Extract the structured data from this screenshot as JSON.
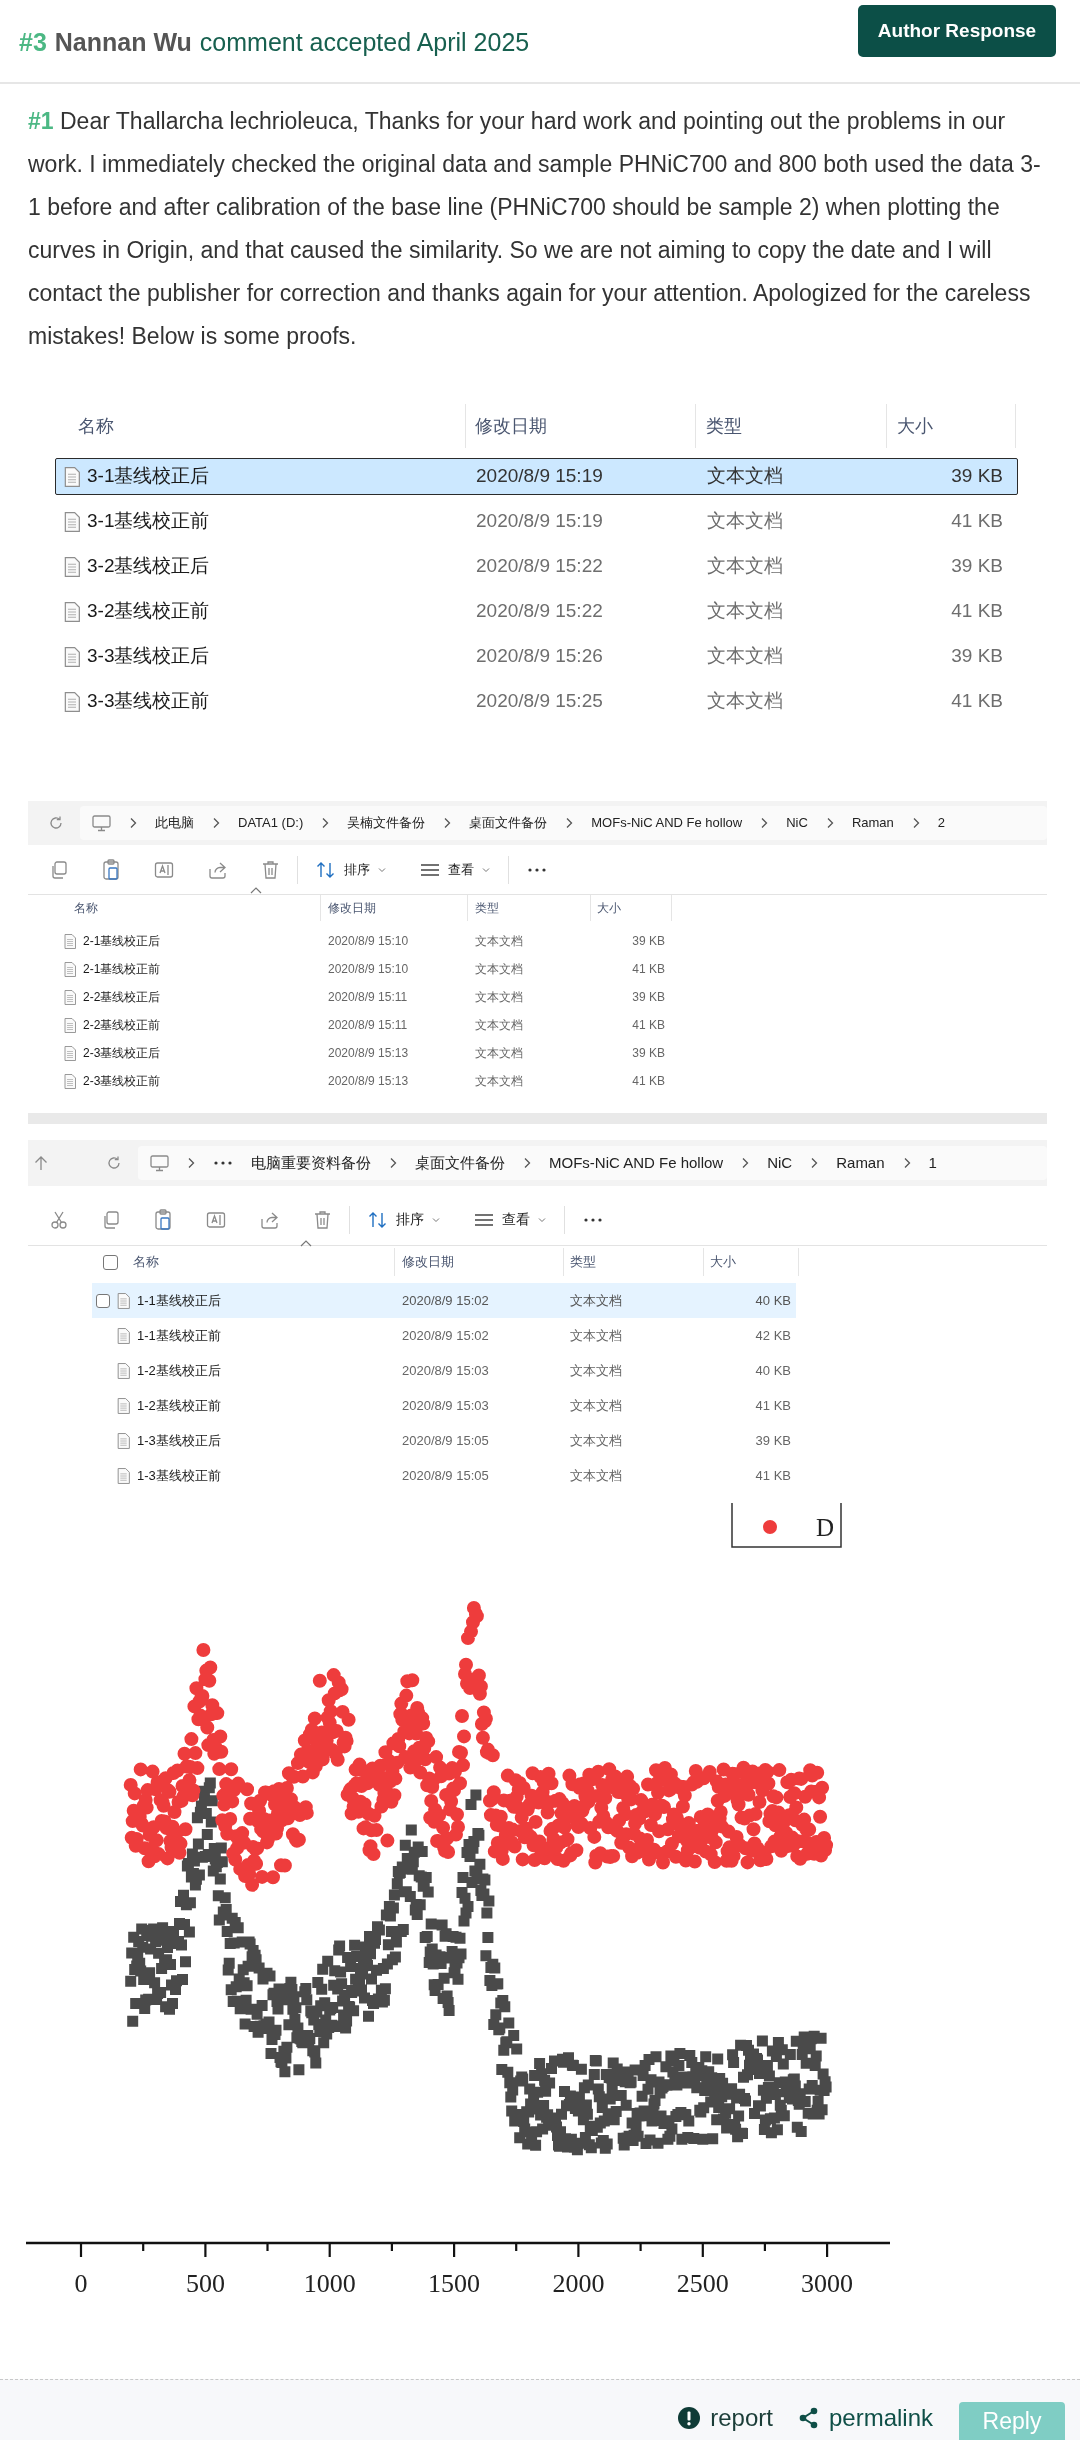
{
  "header": {
    "number": "#3",
    "author": "Nannan Wu",
    "status": "comment accepted April 2025",
    "button": "Author Response"
  },
  "comment": {
    "number": "#1",
    "text": "Dear Thallarcha lechrioleuca, Thanks for your hard work and pointing out the problems in our work. I immediately checked the original data and sample PHNiC700 and 800 both used the data 3-1 before and after calibration of the base line (PHNiC700 should be sample 2) when plotting the curves in Origin, and that caused the similarity. So we are not aiming to copy the date and I will contact the publisher for correction and thanks again for your attention. Apologized for the careless mistakes! Below is some proofs."
  },
  "screenshots": [
    {
      "kind": "large",
      "columns": [
        "名称",
        "修改日期",
        "类型",
        "大小"
      ],
      "files": [
        {
          "name": "3-1基线校正后",
          "date": "2020/8/9 15:19",
          "type": "文本文档",
          "size": "39 KB",
          "selected": true
        },
        {
          "name": "3-1基线校正前",
          "date": "2020/8/9 15:19",
          "type": "文本文档",
          "size": "41 KB",
          "selected": false
        },
        {
          "name": "3-2基线校正后",
          "date": "2020/8/9 15:22",
          "type": "文本文档",
          "size": "39 KB",
          "selected": false
        },
        {
          "name": "3-2基线校正前",
          "date": "2020/8/9 15:22",
          "type": "文本文档",
          "size": "41 KB",
          "selected": false
        },
        {
          "name": "3-3基线校正后",
          "date": "2020/8/9 15:26",
          "type": "文本文档",
          "size": "39 KB",
          "selected": false
        },
        {
          "name": "3-3基线校正前",
          "date": "2020/8/9 15:25",
          "type": "文本文档",
          "size": "41 KB",
          "selected": false
        }
      ]
    },
    {
      "kind": "small",
      "breadcrumb": [
        "此电脑",
        "DATA1 (D:)",
        "吴楠文件备份",
        "桌面文件备份",
        "MOFs-NiC AND Fe hollow",
        "NiC",
        "Raman",
        "2"
      ],
      "breadcrumb_collapsed": false,
      "toolbar": [
        "排序",
        "查看"
      ],
      "columns": [
        "名称",
        "修改日期",
        "类型",
        "大小"
      ],
      "files": [
        {
          "name": "2-1基线校正后",
          "date": "2020/8/9 15:10",
          "type": "文本文档",
          "size": "39 KB",
          "selected": false
        },
        {
          "name": "2-1基线校正前",
          "date": "2020/8/9 15:10",
          "type": "文本文档",
          "size": "41 KB",
          "selected": false
        },
        {
          "name": "2-2基线校正后",
          "date": "2020/8/9 15:11",
          "type": "文本文档",
          "size": "39 KB",
          "selected": false
        },
        {
          "name": "2-2基线校正前",
          "date": "2020/8/9 15:11",
          "type": "文本文档",
          "size": "41 KB",
          "selected": false
        },
        {
          "name": "2-3基线校正后",
          "date": "2020/8/9 15:13",
          "type": "文本文档",
          "size": "39 KB",
          "selected": false
        },
        {
          "name": "2-3基线校正前",
          "date": "2020/8/9 15:13",
          "type": "文本文档",
          "size": "41 KB",
          "selected": false
        }
      ]
    },
    {
      "kind": "medium",
      "breadcrumb": [
        "电脑重要资料备份",
        "桌面文件备份",
        "MOFs-NiC AND Fe hollow",
        "NiC",
        "Raman",
        "1"
      ],
      "breadcrumb_collapsed": true,
      "toolbar": [
        "排序",
        "查看"
      ],
      "header_checkbox": {
        "checked": false
      },
      "columns": [
        "名称",
        "修改日期",
        "类型",
        "大小"
      ],
      "files": [
        {
          "name": "1-1基线校正后",
          "date": "2020/8/9 15:02",
          "type": "文本文档",
          "size": "40 KB",
          "selected": true
        },
        {
          "name": "1-1基线校正前",
          "date": "2020/8/9 15:02",
          "type": "文本文档",
          "size": "42 KB",
          "selected": false
        },
        {
          "name": "1-2基线校正后",
          "date": "2020/8/9 15:03",
          "type": "文本文档",
          "size": "40 KB",
          "selected": false
        },
        {
          "name": "1-2基线校正前",
          "date": "2020/8/9 15:03",
          "type": "文本文档",
          "size": "41 KB",
          "selected": false
        },
        {
          "name": "1-3基线校正后",
          "date": "2020/8/9 15:05",
          "type": "文本文档",
          "size": "39 KB",
          "selected": false
        },
        {
          "name": "1-3基线校正前",
          "date": "2020/8/9 15:05",
          "type": "文本文档",
          "size": "41 KB",
          "selected": false
        }
      ]
    }
  ],
  "chart": {
    "legend": "D",
    "x_tick_labels": [
      "0",
      "500",
      "1000",
      "1500",
      "2000",
      "2500",
      "3000"
    ]
  },
  "footer": {
    "report": "report",
    "permalink": "permalink",
    "reply": "Reply"
  }
}
